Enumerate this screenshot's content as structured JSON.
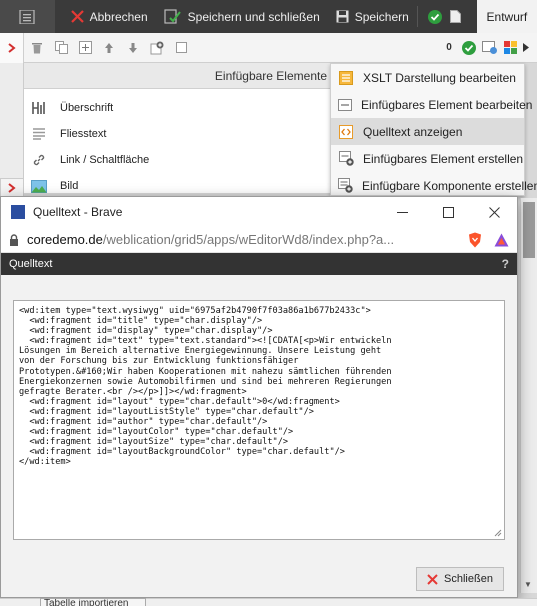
{
  "topbar": {
    "cancel_label": "Abbrechen",
    "save_close_label": "Speichern und schließen",
    "save_label": "Speichern",
    "status_tab": "Entwurf"
  },
  "editor_toolbar": {
    "counter": "0"
  },
  "panel": {
    "title": "Einfügbare Elemente",
    "items": [
      {
        "label": "Überschrift",
        "icon": "heading-icon"
      },
      {
        "label": "Fliesstext",
        "icon": "paragraph-icon"
      },
      {
        "label": "Link / Schaltfläche",
        "icon": "link-icon"
      },
      {
        "label": "Bild",
        "icon": "image-icon"
      }
    ]
  },
  "dropdown": {
    "items": [
      {
        "label": "XSLT Darstellung bearbeiten",
        "icon": "xslt-icon"
      },
      {
        "label": "Einfügbares Element bearbeiten",
        "icon": "edit-element-icon"
      },
      {
        "label": "Quelltext anzeigen",
        "icon": "source-code-icon",
        "highlighted": true
      },
      {
        "label": "Einfügbares Element erstellen",
        "icon": "create-element-icon"
      },
      {
        "label": "Einfügbare Komponente erstellen",
        "icon": "create-component-icon"
      }
    ]
  },
  "popup": {
    "window_title": "Quelltext - Brave",
    "url_domain": "coredemo.de",
    "url_path": "/weblication/grid5/apps/wEditorWd8/index.php?a...",
    "dialog_title": "Quelltext",
    "help": "?",
    "source_lines": [
      "<wd:item type=\"text.wysiwyg\" uid=\"6975af2b4790f7f03a86a1b677b2433c\">",
      "  <wd:fragment id=\"title\" type=\"char.display\"/>",
      "  <wd:fragment id=\"display\" type=\"char.display\"/>",
      "  <wd:fragment id=\"text\" type=\"text.standard\"><![CDATA[<p>Wir entwickeln",
      "Lösungen im Bereich alternative Energiegewinnung. Unsere Leistung geht",
      "von der Forschung bis zur Entwicklung funktionsfähiger",
      "Prototypen.&#160;Wir haben Kooperationen mit nahezu sämtlichen führenden",
      "Energiekonzernen sowie Automobilfirmen und sind bei mehreren Regierungen",
      "gefragte Berater.<br /></p>]]></wd:fragment>",
      "  <wd:fragment id=\"layout\" type=\"char.default\">0</wd:fragment>",
      "  <wd:fragment id=\"layoutListStyle\" type=\"char.default\"/>",
      "  <wd:fragment id=\"author\" type=\"char.default\"/>",
      "  <wd:fragment id=\"layoutColor\" type=\"char.default\"/>",
      "  <wd:fragment id=\"layoutSize\" type=\"char.default\"/>",
      "  <wd:fragment id=\"layoutBackgroundColor\" type=\"char.default\"/>",
      "</wd:item>"
    ],
    "close_label": "Schließen"
  },
  "bottom": {
    "import_label": "Tabelle importieren"
  },
  "colors": {
    "toolbar_bg": "#3a3a3a",
    "cancel_red": "#d32f2f",
    "ok_green": "#2e9e3e",
    "brave_orange": "#fb542b"
  }
}
